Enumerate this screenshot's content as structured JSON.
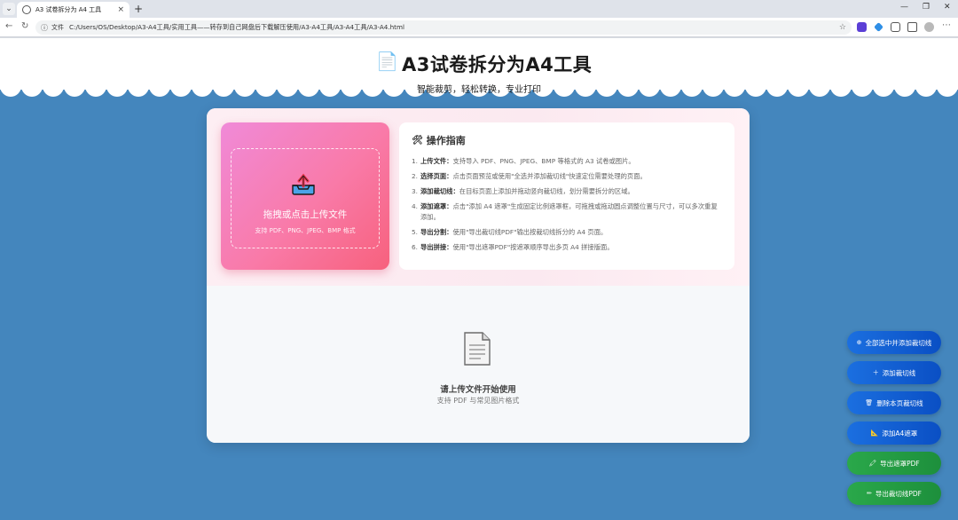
{
  "browser": {
    "tab_title": "A3 试卷拆分为 A4 工具",
    "tab_close": "×",
    "new_tab": "+",
    "file_label": "文件",
    "url": "C:/Users/OS/Desktop/A3-A4工具/实用工具——转存到自己网盘后下载解压使用/A3-A4工具/A3-A4工具/A3-A4.html"
  },
  "header": {
    "logo_icon": "📄",
    "title": "A3试卷拆分为A4工具",
    "subtitle": "智能裁剪，轻松转换，专业打印"
  },
  "upload": {
    "title": "拖拽或点击上传文件",
    "hint": "支持 PDF、PNG、JPEG、BMP 格式"
  },
  "guide": {
    "icon": "🛠",
    "title": "操作指南",
    "steps": [
      {
        "num": "1.",
        "label": "上传文件：",
        "text": "支持导入 PDF、PNG、JPEG、BMP 等格式的 A3 试卷或图片。"
      },
      {
        "num": "2.",
        "label": "选择页面：",
        "text": "点击页面预览或使用\"全选并添加裁切线\"快速定位需要处理的页面。"
      },
      {
        "num": "3.",
        "label": "添加裁切线：",
        "text": "在目标页面上添加并拖动竖向裁切线，划分需要拆分的区域。"
      },
      {
        "num": "4.",
        "label": "添加遮罩：",
        "text": "点击\"添加 A4 遮罩\"生成固定比例遮罩框，可拖拽或拖动圆点调整位置与尺寸，可以多次重复添加。"
      },
      {
        "num": "5.",
        "label": "导出分割：",
        "text": "使用\"导出裁切线PDF\"输出按裁切线拆分的 A4 页面。"
      },
      {
        "num": "6.",
        "label": "导出拼接：",
        "text": "使用\"导出遮罩PDF\"按遮罩顺序导出多页 A4 拼接版面。"
      }
    ]
  },
  "empty": {
    "title": "请上传文件开始使用",
    "hint": "支持 PDF 与常见图片格式"
  },
  "actions": [
    {
      "icon": "⊕",
      "label": "全部选中并添加裁切线",
      "color": "#1b6fe0"
    },
    {
      "icon": "＋",
      "label": "添加裁切线",
      "color": "#1b6fe0"
    },
    {
      "icon": "🗑",
      "label": "删除本页裁切线",
      "color": "#1b6fe0"
    },
    {
      "icon": "📐",
      "label": "添加A4遮罩",
      "color": "#1b6fe0"
    },
    {
      "icon": "🖍",
      "label": "导出遮罩PDF",
      "color": "#2aa84a"
    },
    {
      "icon": "✏",
      "label": "导出裁切线PDF",
      "color": "#2aa84a"
    }
  ]
}
